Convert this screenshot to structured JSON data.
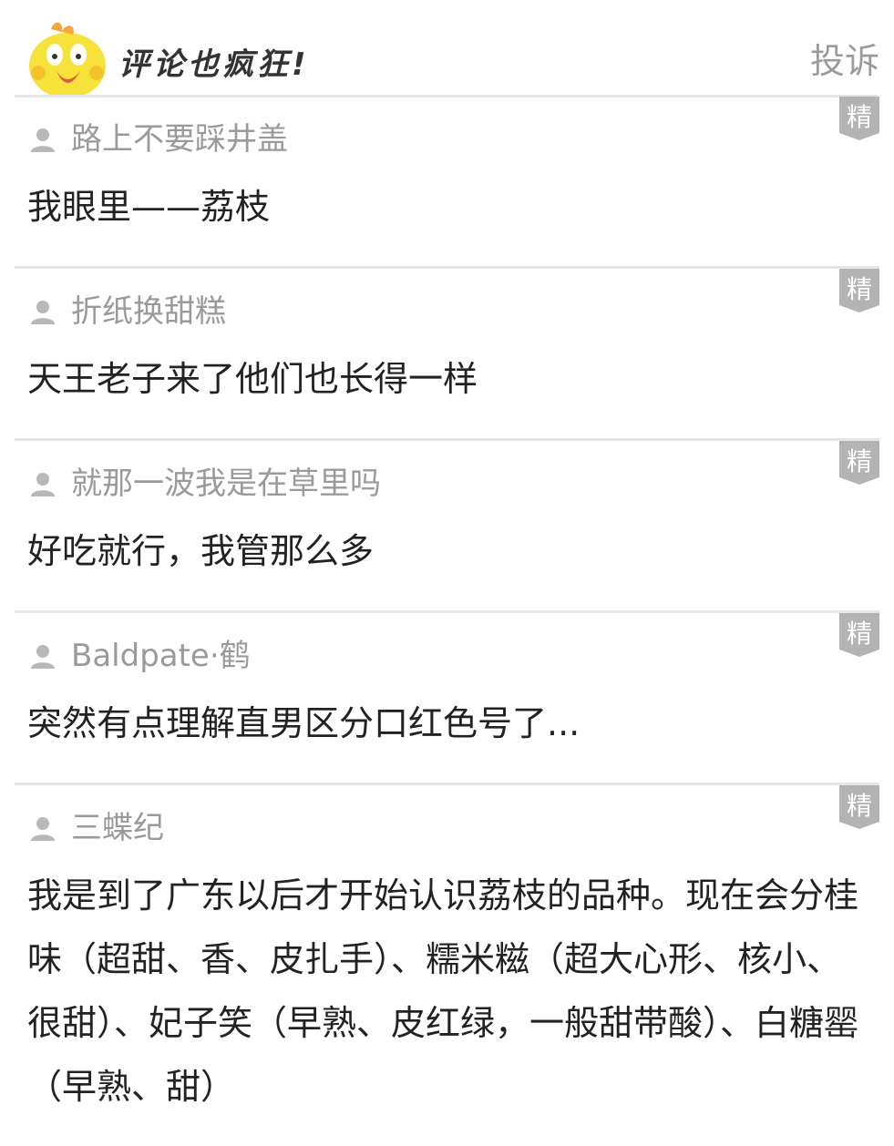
{
  "header": {
    "title": "评论也疯狂!",
    "report_label": "投诉"
  },
  "badge_label": "精",
  "comments": [
    {
      "username": "路上不要踩井盖",
      "text": "我眼里——荔枝"
    },
    {
      "username": "折纸换甜糕",
      "text": "天王老子来了他们也长得一样"
    },
    {
      "username": "就那一波我是在草里吗",
      "text": "好吃就行，我管那么多"
    },
    {
      "username": "Baldpate·鹤",
      "text": "突然有点理解直男区分口红色号了..."
    },
    {
      "username": "三蝶纪",
      "text": "我是到了广东以后才开始认识荔枝的品种。现在会分桂味（超甜、香、皮扎手）、糯米糍（超大心形、核小、很甜）、妃子笑（早熟、皮红绿，一般甜带酸）、白糖罂（早熟、甜）"
    }
  ],
  "colors": {
    "divider": "#e6e6e6",
    "username": "#9a9a9a",
    "text": "#222222",
    "badge": "#b3b3b3",
    "mascot": "#f7e23a"
  }
}
